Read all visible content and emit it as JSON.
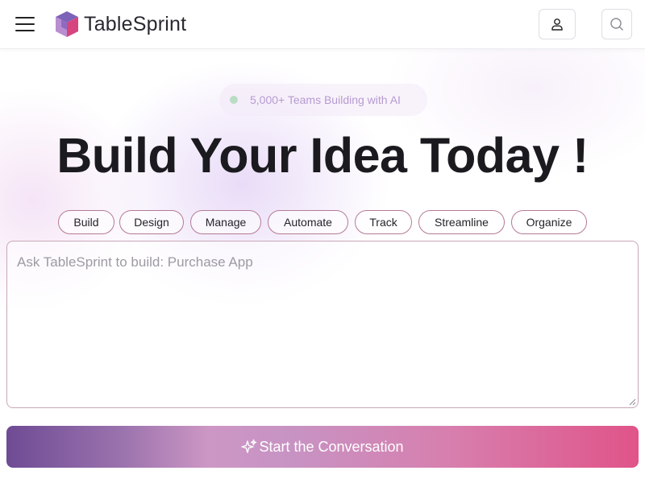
{
  "header": {
    "brand_name": "TableSprint",
    "menu_icon": "hamburger-menu-icon",
    "logo_icon": "cube-logo-icon",
    "profile_icon": "user-icon",
    "search_icon": "search-icon"
  },
  "hero": {
    "badge_text": "5,000+ Teams Building with AI",
    "title": "Build Your Idea Today !",
    "chips": [
      "Build",
      "Design",
      "Manage",
      "Automate",
      "Track",
      "Streamline",
      "Organize"
    ]
  },
  "prompt": {
    "placeholder": "Ask TableSprint to build: Purchase App",
    "value": ""
  },
  "cta": {
    "label": "Start the Conversation",
    "icon": "sparkle-icon"
  },
  "colors": {
    "accent_purple": "#6e4b94",
    "accent_pink": "#e05489",
    "chip_border": "#b57a96",
    "badge_text": "#b79ad0"
  }
}
